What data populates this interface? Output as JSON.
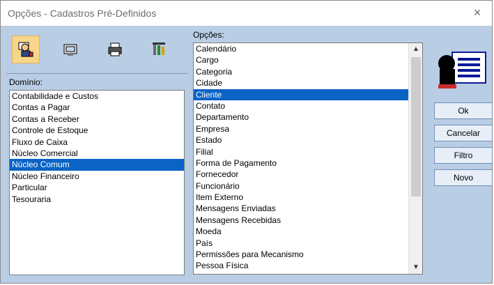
{
  "window": {
    "title": "Opções - Cadastros Pré-Definidos",
    "close": "×"
  },
  "toolbar": {
    "buttons": [
      {
        "icon": "user-settings-icon",
        "active": true
      },
      {
        "icon": "monitor-icon",
        "active": false
      },
      {
        "icon": "printer-icon",
        "active": false
      },
      {
        "icon": "tools-icon",
        "active": false
      }
    ]
  },
  "dominio": {
    "label": "Domínio:",
    "items": [
      "Contabilidade e Custos",
      "Contas a Pagar",
      "Contas a Receber",
      "Controle de Estoque",
      "Fluxo de Caixa",
      "Núcleo Comercial",
      "Núcleo Comum",
      "Núcleo Financeiro",
      "Particular",
      "Tesouraria"
    ],
    "selected": "Núcleo Comum"
  },
  "opcoes": {
    "label": "Opções:",
    "items": [
      "Calendário",
      "Cargo",
      "Categoria",
      "Cidade",
      "Cliente",
      "Contato",
      "Departamento",
      "Empresa",
      "Estado",
      "Filial",
      "Forma de Pagamento",
      "Fornecedor",
      "Funcionário",
      "Item Externo",
      "Mensagens Enviadas",
      "Mensagens Recebidas",
      "Moeda",
      "País",
      "Permissões para Mecanismo",
      "Pessoa Física"
    ],
    "selected": "Cliente"
  },
  "buttons": {
    "ok": "Ok",
    "cancelar": "Cancelar",
    "filtro": "Filtro",
    "novo": "Novo"
  },
  "colors": {
    "background": "#b9cde5",
    "selection": "#0b63c5",
    "toolbar_active": "#f7d58a"
  }
}
